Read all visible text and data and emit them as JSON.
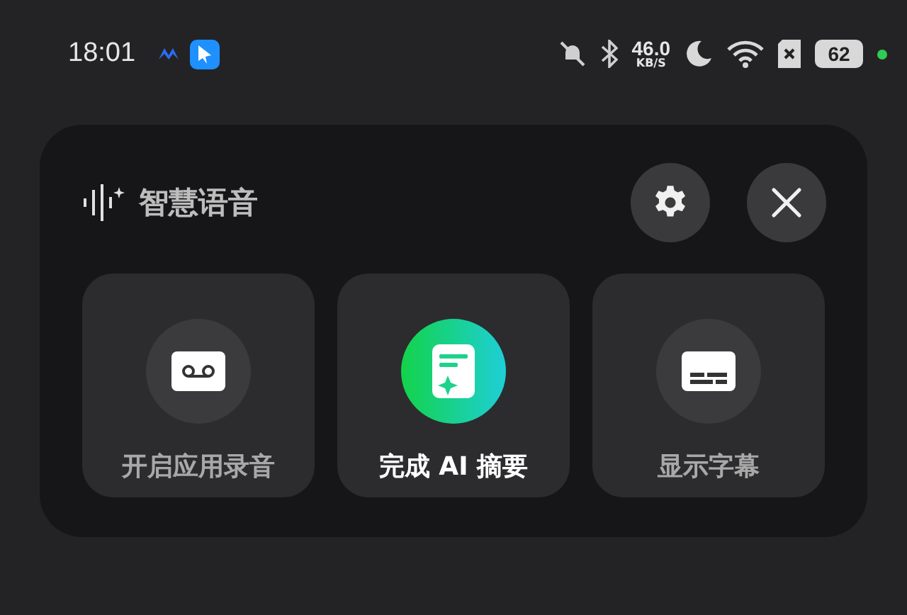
{
  "status_bar": {
    "time": "18:01",
    "speed_value": "46.0",
    "speed_unit": "KB/S",
    "battery": "62"
  },
  "panel": {
    "title": "智慧语音",
    "actions": [
      {
        "kind": "record",
        "label": "开启应用录音",
        "active": false
      },
      {
        "kind": "summary",
        "label": "完成 AI 摘要",
        "active": true
      },
      {
        "kind": "subtitles",
        "label": "显示字幕",
        "active": false
      }
    ]
  }
}
